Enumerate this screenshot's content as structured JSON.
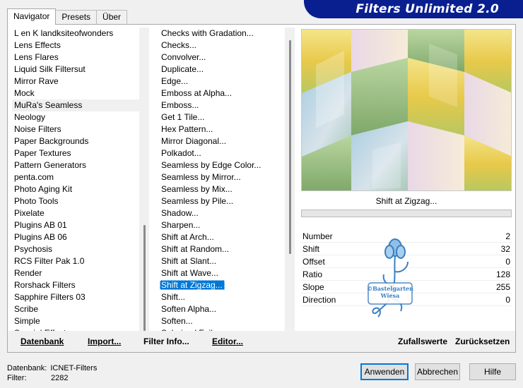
{
  "tabs": [
    "Navigator",
    "Presets",
    "Über"
  ],
  "app_title": "Filters Unlimited 2.0",
  "categories": {
    "items": [
      "L en K landksiteofwonders",
      "Lens Effects",
      "Lens Flares",
      "Liquid Silk Filtersut",
      "Mirror Rave",
      "Mock",
      "MuRa's Seamless",
      "Neology",
      "Noise Filters",
      "Paper Backgrounds",
      "Paper Textures",
      "Pattern Generators",
      "penta.com",
      "Photo Aging Kit",
      "Photo Tools",
      "Pixelate",
      "Plugins AB 01",
      "Plugins AB 06",
      "Psychosis",
      "RCS Filter Pak 1.0",
      "Render",
      "Rorshack Filters",
      "Sapphire Filters 03",
      "Scribe",
      "Simple",
      "Special Effects"
    ],
    "selected": "MuRa's Seamless"
  },
  "filters": {
    "items": [
      "Checks with Gradation...",
      "Checks...",
      "Convolver...",
      "Duplicate...",
      "Edge...",
      "Emboss at Alpha...",
      "Emboss...",
      "Get 1 Tile...",
      "Hex Pattern...",
      "Mirror Diagonal...",
      "Polkadot...",
      "Seamless by Edge Color...",
      "Seamless by Mirror...",
      "Seamless by Mix...",
      "Seamless by Pile...",
      "Shadow...",
      "Sharpen...",
      "Shift at Arch...",
      "Shift at Random...",
      "Shift at Slant...",
      "Shift at Wave...",
      "Shift at Zigzag...",
      "Shift...",
      "Soften Alpha...",
      "Soften...",
      "Solarized Foil..."
    ],
    "selected": "Shift at Zigzag..."
  },
  "preview": {
    "filter_name": "Shift at Zigzag..."
  },
  "params": [
    {
      "label": "Number",
      "value": "2"
    },
    {
      "label": "Shift",
      "value": "32"
    },
    {
      "label": "Offset",
      "value": "0"
    },
    {
      "label": "Ratio",
      "value": "128"
    },
    {
      "label": "Slope",
      "value": "255"
    },
    {
      "label": "Direction",
      "value": "0"
    }
  ],
  "watermark": {
    "line1": "©Bastelgarten",
    "line2": "Wiesa"
  },
  "bottom_buttons": {
    "datenbank": "Datenbank",
    "import": "Import...",
    "filter_info": "Filter Info...",
    "editor": "Editor...",
    "zufallswerte": "Zufallswerte",
    "zuruecksetzen": "Zurücksetzen"
  },
  "status": {
    "db_label": "Datenbank:",
    "db_value": "ICNET-Filters",
    "filter_label": "Filter:",
    "filter_value": "2282"
  },
  "dialog_buttons": {
    "apply": "Anwenden",
    "cancel": "Abbrechen",
    "help": "Hilfe"
  },
  "colors": {
    "banner": "#0a1f8f",
    "selection": "#0078d7",
    "watermark": "#3b7fc0"
  }
}
